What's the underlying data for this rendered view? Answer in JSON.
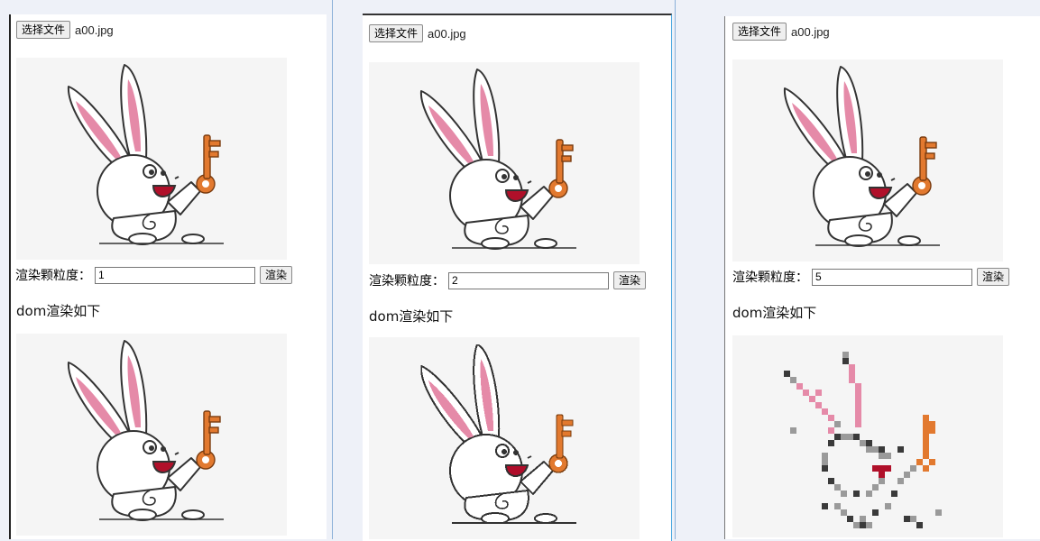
{
  "panels": [
    {
      "file_button": "选择文件",
      "file_name": "a00.jpg",
      "granularity_label": "渲染颗粒度：",
      "granularity_value": "1",
      "render_button": "渲染",
      "dom_title": "dom渲染如下",
      "render_style": "smooth"
    },
    {
      "file_button": "选择文件",
      "file_name": "a00.jpg",
      "granularity_label": "渲染颗粒度：",
      "granularity_value": "2",
      "render_button": "渲染",
      "dom_title": "dom渲染如下",
      "render_style": "jagged"
    },
    {
      "file_button": "选择文件",
      "file_name": "a00.jpg",
      "granularity_label": "渲染颗粒度：",
      "granularity_value": "5",
      "render_button": "渲染",
      "dom_title": "dom渲染如下",
      "render_style": "pixelated"
    }
  ],
  "image": {
    "subject": "cartoon rabbit holding key",
    "colors": {
      "background": "#f5f5f5",
      "ear_inner": "#e58aa8",
      "key": "#e2792f",
      "mouth": "#b0102a",
      "outline": "#333333"
    }
  }
}
